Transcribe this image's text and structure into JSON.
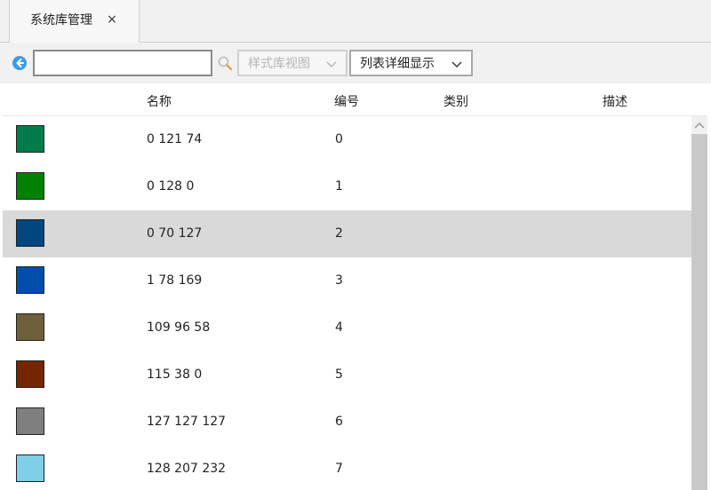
{
  "tab": {
    "label": "系统库管理",
    "close_glyph": "×"
  },
  "toolbar": {
    "back_icon": "back-arrow-icon",
    "search_placeholder": "",
    "search_value": "",
    "search_icon": "search-icon",
    "style_view_label": "样式库视图",
    "list_view_label": "列表详细显示"
  },
  "table": {
    "headers": {
      "name": "名称",
      "number": "编号",
      "category": "类别",
      "description": "描述"
    },
    "rows": [
      {
        "color": "#007b4a",
        "name": "0 121 74",
        "number": "0",
        "category": "",
        "description": ""
      },
      {
        "color": "#008000",
        "name": "0 128 0",
        "number": "1",
        "category": "",
        "description": ""
      },
      {
        "color": "#00467f",
        "name": "0 70 127",
        "number": "2",
        "category": "",
        "description": "",
        "selected": true
      },
      {
        "color": "#014ea9",
        "name": "1 78 169",
        "number": "3",
        "category": "",
        "description": ""
      },
      {
        "color": "#6d603a",
        "name": "109 96 58",
        "number": "4",
        "category": "",
        "description": ""
      },
      {
        "color": "#732600",
        "name": "115 38 0",
        "number": "5",
        "category": "",
        "description": ""
      },
      {
        "color": "#7f7f7f",
        "name": "127 127 127",
        "number": "6",
        "category": "",
        "description": ""
      },
      {
        "color": "#80cfe8",
        "name": "128 207 232",
        "number": "7",
        "category": "",
        "description": ""
      }
    ]
  },
  "colors": {
    "selected_row": "#d9d9d9",
    "toolbar_bg": "#f1f1f1",
    "back_icon_color": "#3d9be9"
  }
}
